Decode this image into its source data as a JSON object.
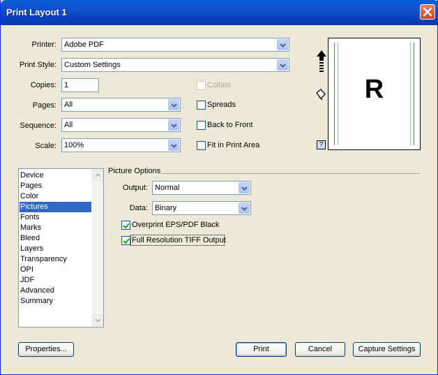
{
  "window": {
    "title": "Print Layout 1"
  },
  "fields": {
    "printer": {
      "label": "Printer:",
      "value": "Adobe PDF"
    },
    "print_style": {
      "label": "Print Style:",
      "value": "Custom Settings"
    },
    "copies": {
      "label": "Copies:",
      "value": "1"
    },
    "pages": {
      "label": "Pages:",
      "value": "All"
    },
    "sequence": {
      "label": "Sequence:",
      "value": "All"
    },
    "scale": {
      "label": "Scale:",
      "value": "100%"
    }
  },
  "checkboxes": {
    "collate": {
      "label": "Collate",
      "checked": false,
      "enabled": false
    },
    "spreads": {
      "label": "Spreads",
      "checked": false
    },
    "back_to_front": {
      "label": "Back to Front",
      "checked": false
    },
    "fit_in_print_area": {
      "label": "Fit in Print Area",
      "checked": false
    }
  },
  "preview": {
    "letter": "R",
    "help": "?"
  },
  "sidebar": {
    "items": [
      "Device",
      "Pages",
      "Color",
      "Pictures",
      "Fonts",
      "Marks",
      "Bleed",
      "Layers",
      "Transparency",
      "OPI",
      "JDF",
      "Advanced",
      "Summary"
    ],
    "selected": "Pictures"
  },
  "picture_options": {
    "heading": "Picture Options",
    "output": {
      "label": "Output:",
      "value": "Normal"
    },
    "data": {
      "label": "Data:",
      "value": "Binary"
    },
    "overprint": {
      "label": "Overprint EPS/PDF Black",
      "checked": true
    },
    "full_resolution": {
      "label": "Full Resolution TIFF Output",
      "checked": true
    }
  },
  "buttons": {
    "properties": "Properties...",
    "print": "Print",
    "cancel": "Cancel",
    "capture": "Capture Settings"
  }
}
